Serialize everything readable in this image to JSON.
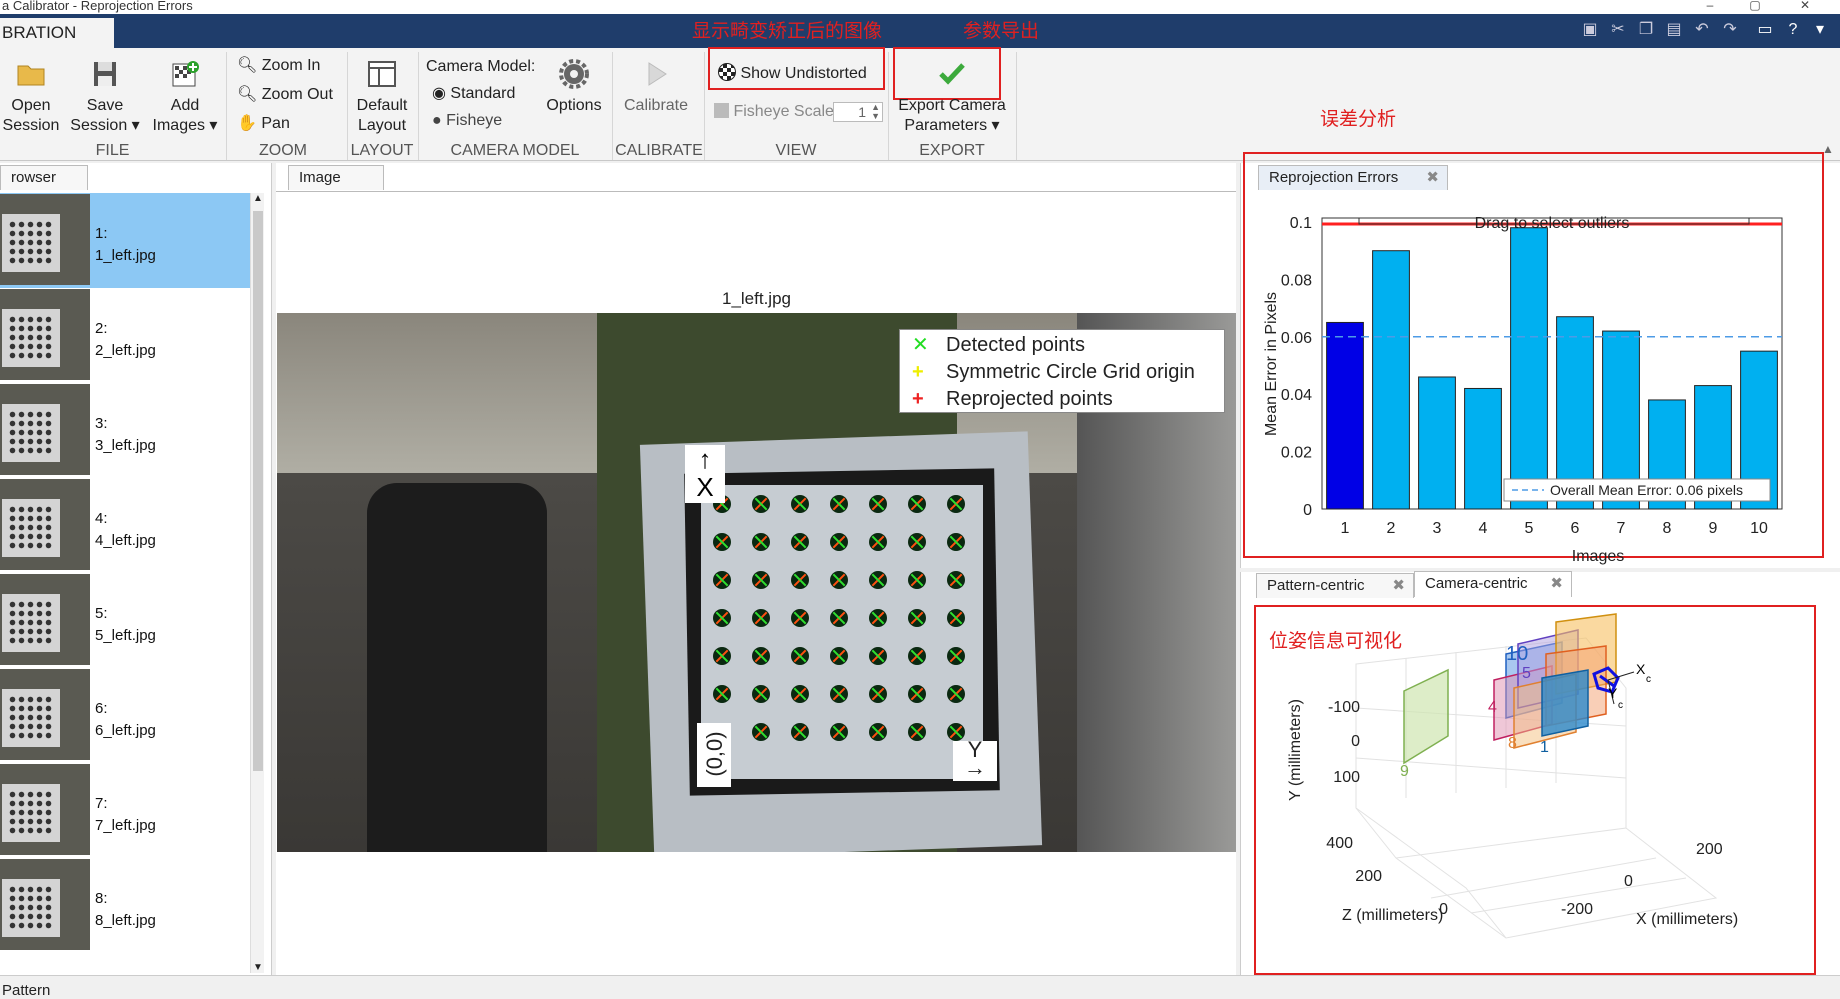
{
  "window": {
    "title": "a Calibrator - Reprojection Errors",
    "app_tab": "BRATION"
  },
  "annotations": {
    "undistort_note": "显示畸变矫正后的图像",
    "export_note": "参数导出",
    "error_note": "误差分析",
    "pose_note": "位姿信息可视化"
  },
  "toolstrip": {
    "file": {
      "label": "FILE",
      "open": [
        "Open",
        "Session"
      ],
      "save": [
        "Save",
        "Session"
      ],
      "add": [
        "Add",
        "Images"
      ]
    },
    "zoom": {
      "label": "ZOOM",
      "zoom_in": "Zoom In",
      "zoom_out": "Zoom Out",
      "pan": "Pan"
    },
    "layout": {
      "label": "LAYOUT",
      "default": [
        "Default",
        "Layout"
      ]
    },
    "camera_model": {
      "label": "CAMERA MODEL",
      "title": "Camera Model:",
      "standard": "Standard",
      "fisheye": "Fisheye",
      "options": "Options"
    },
    "calibrate": {
      "label": "CALIBRATE",
      "button": "Calibrate"
    },
    "view": {
      "label": "VIEW",
      "show_undistorted": "Show Undistorted",
      "fisheye_scale": "Fisheye Scale",
      "fisheye_scale_value": "1"
    },
    "export": {
      "label": "EXPORT",
      "button": [
        "Export Camera",
        "Parameters"
      ]
    }
  },
  "browser": {
    "tab": "rowser",
    "items": [
      {
        "num": "1:",
        "file": "1_left.jpg",
        "selected": true
      },
      {
        "num": "2:",
        "file": "2_left.jpg"
      },
      {
        "num": "3:",
        "file": "3_left.jpg"
      },
      {
        "num": "4:",
        "file": "4_left.jpg"
      },
      {
        "num": "5:",
        "file": "5_left.jpg"
      },
      {
        "num": "6:",
        "file": "6_left.jpg"
      },
      {
        "num": "7:",
        "file": "7_left.jpg"
      },
      {
        "num": "8:",
        "file": "8_left.jpg"
      }
    ]
  },
  "image_panel": {
    "tab": "Image",
    "image_title": "1_left.jpg",
    "legend": [
      "Detected points",
      "Symmetric Circle Grid origin",
      "Reprojected points"
    ],
    "axis_x": "X",
    "axis_y": "Y",
    "origin": "(0,0)"
  },
  "reprojection": {
    "tab": "Reprojection Errors",
    "drag_text": "Drag to select outliers",
    "overall_text": "Overall Mean Error: 0.06 pixels",
    "colors": {
      "selected": "#0000e6",
      "bar": "#00b0f0",
      "mean": "#4d9be6",
      "line": "#ff2020"
    }
  },
  "chart_data": {
    "type": "bar",
    "categories": [
      "1",
      "2",
      "3",
      "4",
      "5",
      "6",
      "7",
      "8",
      "9",
      "10"
    ],
    "values": [
      0.065,
      0.09,
      0.046,
      0.042,
      0.098,
      0.067,
      0.062,
      0.038,
      0.043,
      0.055
    ],
    "xlabel": "Images",
    "ylabel": "Mean Error in Pixels",
    "yticks": [
      "0",
      "0.02",
      "0.04",
      "0.06",
      "0.08",
      "0.1"
    ],
    "ylim": [
      0,
      0.1
    ],
    "mean": 0.06,
    "selected_index": 0
  },
  "pose": {
    "tabs": [
      "Pattern-centric",
      "Camera-centric"
    ],
    "active_tab": "Camera-centric",
    "ylabel": "Y (millimeters)",
    "zlabel": "Z (millimeters)",
    "xlabel": "X (millimeters)",
    "y_ticks": [
      "-100",
      "0",
      "100"
    ],
    "z_ticks": [
      "400",
      "200",
      "0"
    ],
    "x_ticks": [
      "200",
      "0",
      "-200"
    ],
    "plane_labels": [
      "10",
      "4",
      "5",
      "8",
      "1",
      "9"
    ],
    "camera_axes": [
      "X",
      "c",
      "Y",
      "c"
    ]
  },
  "status": {
    "text": "Pattern"
  }
}
